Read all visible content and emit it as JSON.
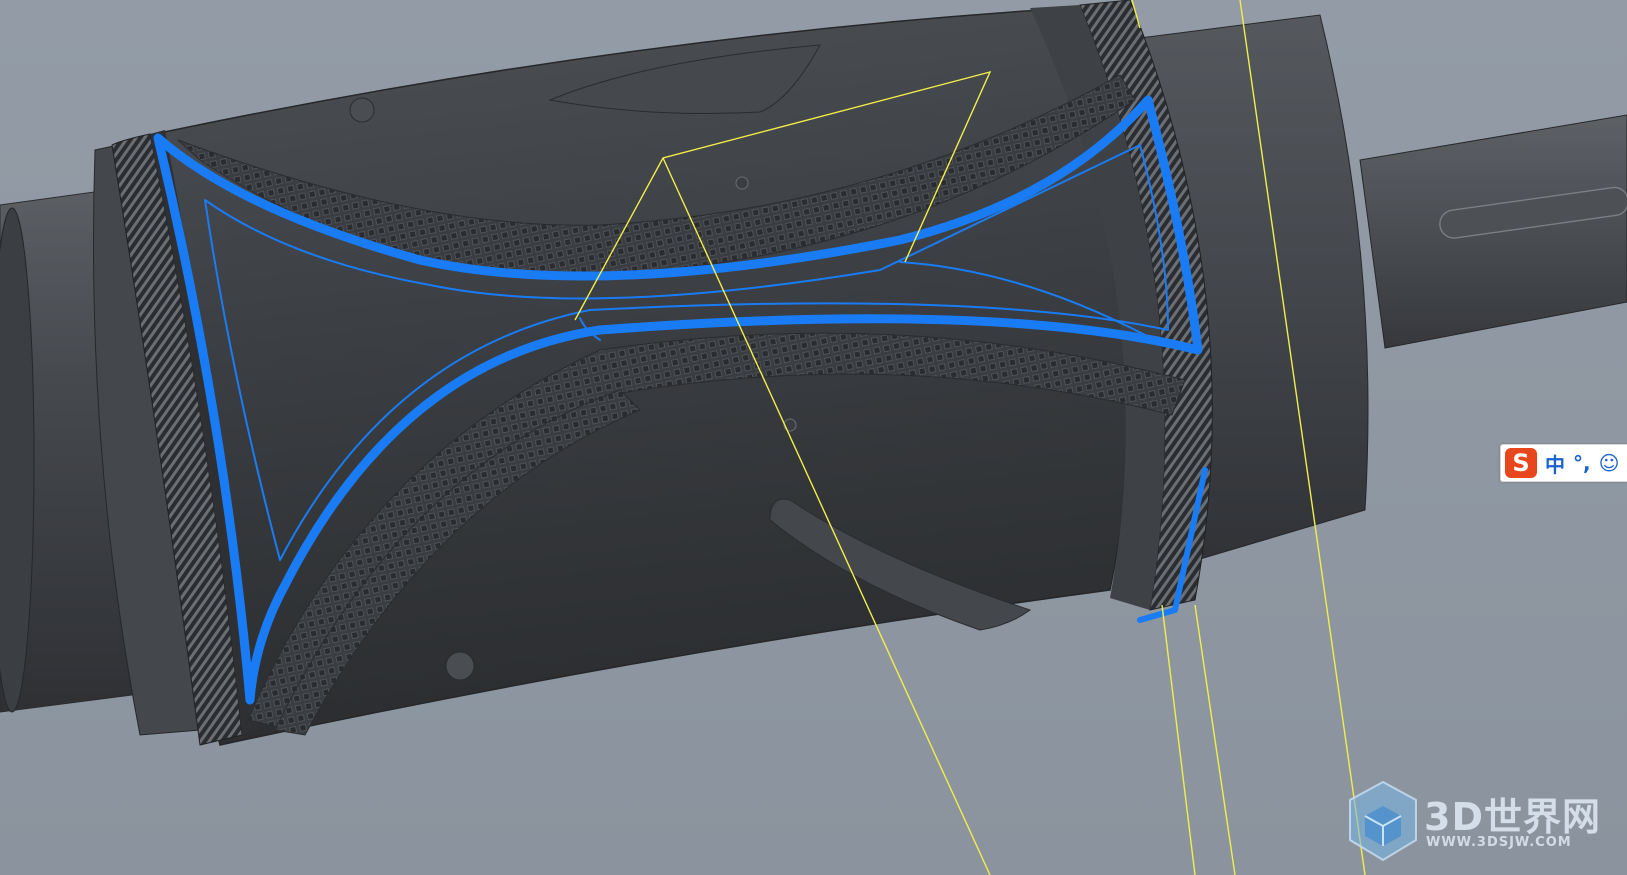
{
  "window": {
    "title": ""
  },
  "colors": {
    "background": "#8f98a2",
    "model_body": "#3c3f43",
    "toolpath": "#1a7cf5",
    "reference_lines": "#f2ee4a"
  },
  "ime": {
    "logo": "S",
    "mode": "中",
    "punct": "°,",
    "extra": "☺"
  },
  "watermark": {
    "brand": "3D世界网",
    "url": "WWW.3DSJW.COM",
    "icon": "cube-icon"
  }
}
